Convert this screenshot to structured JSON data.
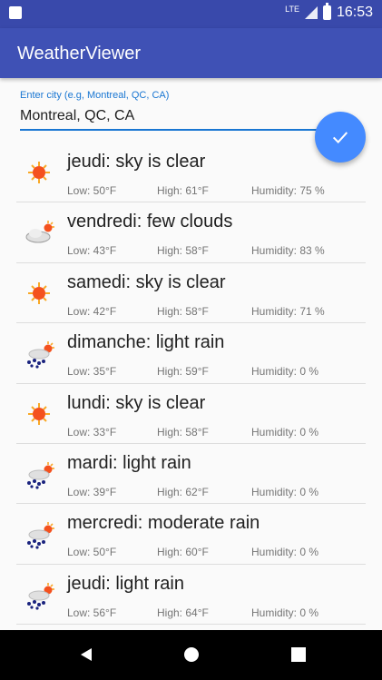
{
  "status": {
    "network": "LTE",
    "time": "16:53"
  },
  "app": {
    "title": "WeatherViewer"
  },
  "search": {
    "label": "Enter city (e.g, Montreal, QC, CA)",
    "value": "Montreal, QC, CA"
  },
  "forecast": [
    {
      "title": "jeudi: sky is clear",
      "low": "Low: 50°F",
      "high": "High: 61°F",
      "humidity": "Humidity: 75 %",
      "icon": "sun-icon"
    },
    {
      "title": "vendredi: few clouds",
      "low": "Low: 43°F",
      "high": "High: 58°F",
      "humidity": "Humidity: 83 %",
      "icon": "few-clouds-icon"
    },
    {
      "title": "samedi: sky is clear",
      "low": "Low: 42°F",
      "high": "High: 58°F",
      "humidity": "Humidity: 71 %",
      "icon": "sun-icon"
    },
    {
      "title": "dimanche: light rain",
      "low": "Low: 35°F",
      "high": "High: 59°F",
      "humidity": "Humidity: 0 %",
      "icon": "rain-icon"
    },
    {
      "title": "lundi: sky is clear",
      "low": "Low: 33°F",
      "high": "High: 58°F",
      "humidity": "Humidity: 0 %",
      "icon": "sun-icon"
    },
    {
      "title": "mardi: light rain",
      "low": "Low: 39°F",
      "high": "High: 62°F",
      "humidity": "Humidity: 0 %",
      "icon": "rain-icon"
    },
    {
      "title": "mercredi: moderate rain",
      "low": "Low: 50°F",
      "high": "High: 60°F",
      "humidity": "Humidity: 0 %",
      "icon": "rain-icon"
    },
    {
      "title": "jeudi: light rain",
      "low": "Low: 56°F",
      "high": "High: 64°F",
      "humidity": "Humidity: 0 %",
      "icon": "rain-icon"
    }
  ],
  "colors": {
    "primary": "#3f51b5",
    "primary_dark": "#3949ab",
    "accent": "#448aff",
    "sun": "#f4511e"
  }
}
